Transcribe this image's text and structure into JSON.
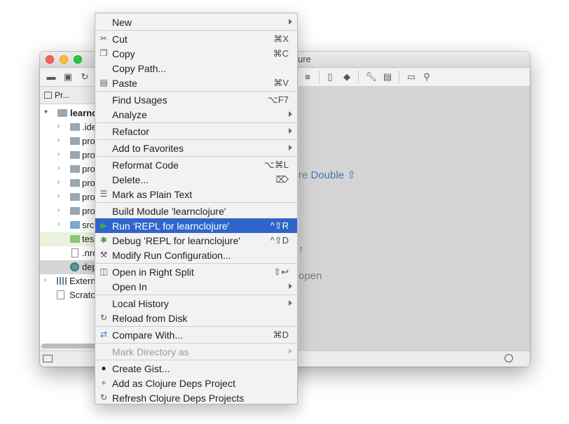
{
  "window": {
    "title_fragment": "ure"
  },
  "project_panel": {
    "label": "Pr..."
  },
  "tree": [
    {
      "text": "learnc",
      "bold": true
    },
    {
      "text": ".ide"
    },
    {
      "text": "pro"
    },
    {
      "text": "pro"
    },
    {
      "text": "pro"
    },
    {
      "text": "pro"
    },
    {
      "text": "pro"
    },
    {
      "text": "pro"
    },
    {
      "text": "src"
    },
    {
      "text": "tes"
    },
    {
      "text": ".nre"
    },
    {
      "text": "dep"
    },
    {
      "text": "Extern"
    },
    {
      "text": "Scrato"
    }
  ],
  "editor_hints": {
    "search_prefix": "re",
    "search_key": "Double ⇧",
    "arrow": "↑",
    "open": "open"
  },
  "context_menu": {
    "items": [
      {
        "label": "New",
        "shortcut": "",
        "submenu": true,
        "icon": ""
      },
      {
        "label": "Cut",
        "shortcut": "⌘X",
        "icon": "scissors-icon"
      },
      {
        "label": "Copy",
        "shortcut": "⌘C",
        "icon": "copy-icon"
      },
      {
        "label": "Copy Path...",
        "shortcut": "",
        "icon": ""
      },
      {
        "label": "Paste",
        "shortcut": "⌘V",
        "icon": "paste-icon"
      },
      {
        "label": "Find Usages",
        "shortcut": "⌥F7",
        "icon": ""
      },
      {
        "label": "Analyze",
        "shortcut": "",
        "submenu": true,
        "icon": ""
      },
      {
        "label": "Refactor",
        "shortcut": "",
        "submenu": true,
        "icon": ""
      },
      {
        "label": "Add to Favorites",
        "shortcut": "",
        "submenu": true,
        "icon": ""
      },
      {
        "label": "Reformat Code",
        "shortcut": "⌥⌘L",
        "icon": ""
      },
      {
        "label": "Delete...",
        "shortcut": "⌦",
        "icon": ""
      },
      {
        "label": "Mark as Plain Text",
        "shortcut": "",
        "icon": "plain-text-icon"
      },
      {
        "label": "Build Module 'learnclojure'",
        "shortcut": "",
        "icon": ""
      },
      {
        "label": "Run 'REPL for learnclojure'",
        "shortcut": "^⇧R",
        "icon": "run-icon",
        "highlighted": true
      },
      {
        "label": "Debug 'REPL for learnclojure'",
        "shortcut": "^⇧D",
        "icon": "debug-icon"
      },
      {
        "label": "Modify Run Configuration...",
        "shortcut": "",
        "icon": "wrench-icon"
      },
      {
        "label": "Open in Right Split",
        "shortcut": "⇧↩",
        "icon": "split-icon"
      },
      {
        "label": "Open In",
        "shortcut": "",
        "submenu": true,
        "icon": ""
      },
      {
        "label": "Local History",
        "shortcut": "",
        "submenu": true,
        "icon": ""
      },
      {
        "label": "Reload from Disk",
        "shortcut": "",
        "icon": "reload-icon"
      },
      {
        "label": "Compare With...",
        "shortcut": "⌘D",
        "icon": "compare-icon"
      },
      {
        "label": "Mark Directory as",
        "shortcut": "",
        "submenu": true,
        "disabled": true,
        "icon": ""
      },
      {
        "label": "Create Gist...",
        "shortcut": "",
        "icon": "github-icon"
      },
      {
        "label": "Add as Clojure Deps Project",
        "shortcut": "",
        "icon": "plus-icon"
      },
      {
        "label": "Refresh Clojure Deps Projects",
        "shortcut": "",
        "icon": "refresh-icon"
      }
    ]
  }
}
